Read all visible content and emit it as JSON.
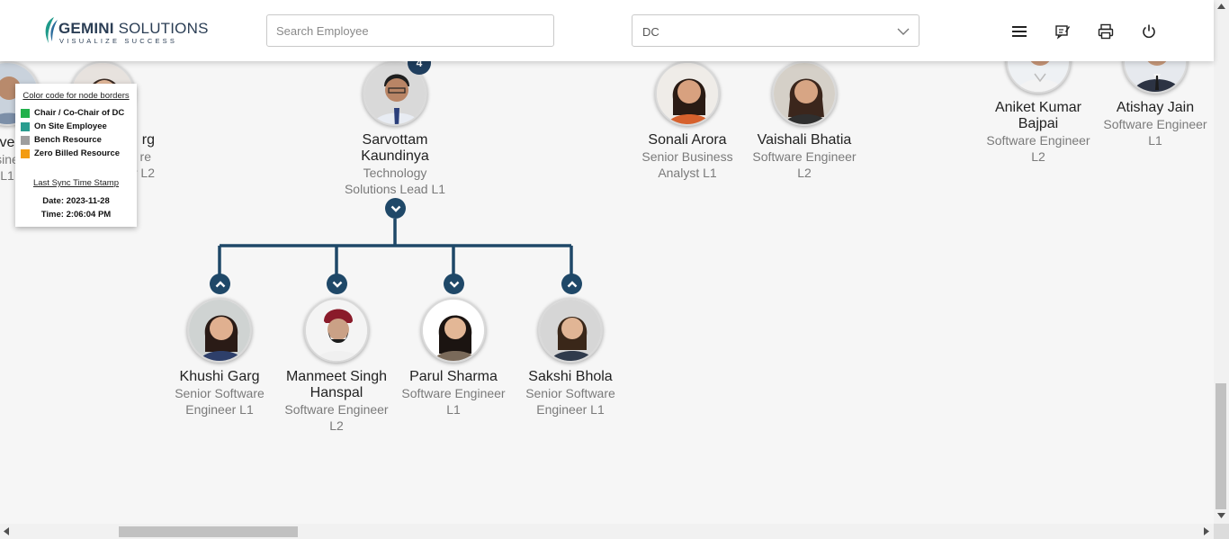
{
  "header": {
    "logo_name_bold": "GEMINI",
    "logo_name_rest": " SOLUTIONS",
    "logo_tagline": "VISUALIZE SUCCESS",
    "search_placeholder": "Search Employee",
    "department_selected": "DC",
    "icons": [
      "menu-icon",
      "feedback-icon",
      "print-icon",
      "power-icon"
    ]
  },
  "legend": {
    "title": "Color code for node borders",
    "items": [
      {
        "label": "Chair / Co-Chair of DC",
        "color": "#22b14c"
      },
      {
        "label": "On Site Employee",
        "color": "#2a9d8f"
      },
      {
        "label": "Bench Resource",
        "color": "#9e9e9e"
      },
      {
        "label": "Zero Billed Resource",
        "color": "#f39c12"
      }
    ],
    "sync_title": "Last Sync Time Stamp",
    "sync_date": "Date: 2023-11-28",
    "sync_time": "Time: 2:06:04 PM"
  },
  "nodes": {
    "partial_left_1": {
      "name": "ve",
      "role_1": "sine",
      "role_2": "L1"
    },
    "partial_left_2": {
      "name": "rg",
      "role_1": "re",
      "role_2": "Engineer L2"
    },
    "sarvottam": {
      "name_1": "Sarvottam",
      "name_2": "Kaundinya",
      "role_1": "Technology",
      "role_2": "Solutions Lead L1",
      "reports": "4"
    },
    "sonali": {
      "name": "Sonali Arora",
      "role_1": "Senior Business",
      "role_2": "Analyst L1"
    },
    "vaishali": {
      "name": "Vaishali Bhatia",
      "role_1": "Software Engineer",
      "role_2": "L2"
    },
    "aniket": {
      "name_1": "Aniket Kumar",
      "name_2": "Bajpai",
      "role_1": "Software Engineer",
      "role_2": "L2"
    },
    "atishay": {
      "name": "Atishay Jain",
      "role_1": "Software Engineer",
      "role_2": "L1"
    },
    "khushi": {
      "name": "Khushi Garg",
      "role_1": "Senior Software",
      "role_2": "Engineer L1"
    },
    "manmeet": {
      "name_1": "Manmeet Singh",
      "name_2": "Hanspal",
      "role_1": "Software Engineer",
      "role_2": "L2"
    },
    "parul": {
      "name": "Parul Sharma",
      "role_1": "Software Engineer",
      "role_2": "L1"
    },
    "sakshi": {
      "name": "Sakshi Bhola",
      "role_1": "Senior Software",
      "role_2": "Engineer L1"
    }
  },
  "colors": {
    "connector": "#1f4868",
    "toggle": "#1f4868",
    "badge": "#1f3e5e"
  }
}
